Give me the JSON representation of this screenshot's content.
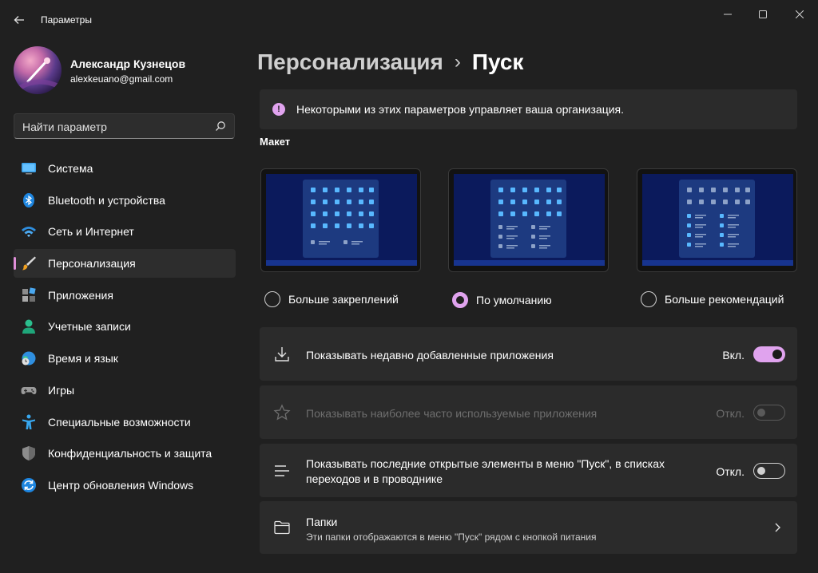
{
  "window": {
    "title": "Параметры"
  },
  "profile": {
    "name": "Александр Кузнецов",
    "email": "alexkeuano@gmail.com"
  },
  "search": {
    "placeholder": "Найти параметр"
  },
  "sidebar": {
    "items": [
      {
        "label": "Система",
        "icon": "system-icon"
      },
      {
        "label": "Bluetooth и устройства",
        "icon": "bluetooth-icon"
      },
      {
        "label": "Сеть и Интернет",
        "icon": "wifi-icon"
      },
      {
        "label": "Персонализация",
        "icon": "brush-icon",
        "active": true
      },
      {
        "label": "Приложения",
        "icon": "apps-icon"
      },
      {
        "label": "Учетные записи",
        "icon": "account-icon"
      },
      {
        "label": "Время и язык",
        "icon": "globe-clock-icon"
      },
      {
        "label": "Игры",
        "icon": "gamepad-icon"
      },
      {
        "label": "Специальные возможности",
        "icon": "accessibility-icon"
      },
      {
        "label": "Конфиденциальность и защита",
        "icon": "shield-icon"
      },
      {
        "label": "Центр обновления Windows",
        "icon": "update-icon"
      }
    ]
  },
  "breadcrumb": {
    "parent": "Персонализация",
    "separator": "›",
    "current": "Пуск"
  },
  "info": {
    "text": "Некоторыми из этих параметров управляет ваша организация."
  },
  "layout_section": {
    "title": "Макет",
    "options": [
      {
        "label": "Больше закреплений",
        "selected": false
      },
      {
        "label": "По умолчанию",
        "selected": true
      },
      {
        "label": "Больше рекомендаций",
        "selected": false
      }
    ]
  },
  "settings": [
    {
      "label": "Показывать недавно добавленные приложения",
      "state": "Вкл.",
      "on": true,
      "disabled": false,
      "icon": "download-icon"
    },
    {
      "label": "Показывать наиболее часто используемые приложения",
      "state": "Откл.",
      "on": false,
      "disabled": true,
      "icon": "star-icon"
    },
    {
      "label_line1": "Показывать последние открытые элементы в меню \"Пуск\", в списках",
      "label_line2": "переходов и в проводнике",
      "state": "Откл.",
      "on": false,
      "disabled": false,
      "icon": "list-icon"
    },
    {
      "label": "Папки",
      "sublabel": "Эти папки отображаются в меню \"Пуск\" рядом с кнопкой питания",
      "icon": "folder-icon"
    }
  ],
  "colors": {
    "accent": "#e0a3ee",
    "background": "#202020",
    "card": "#2b2b2b"
  }
}
